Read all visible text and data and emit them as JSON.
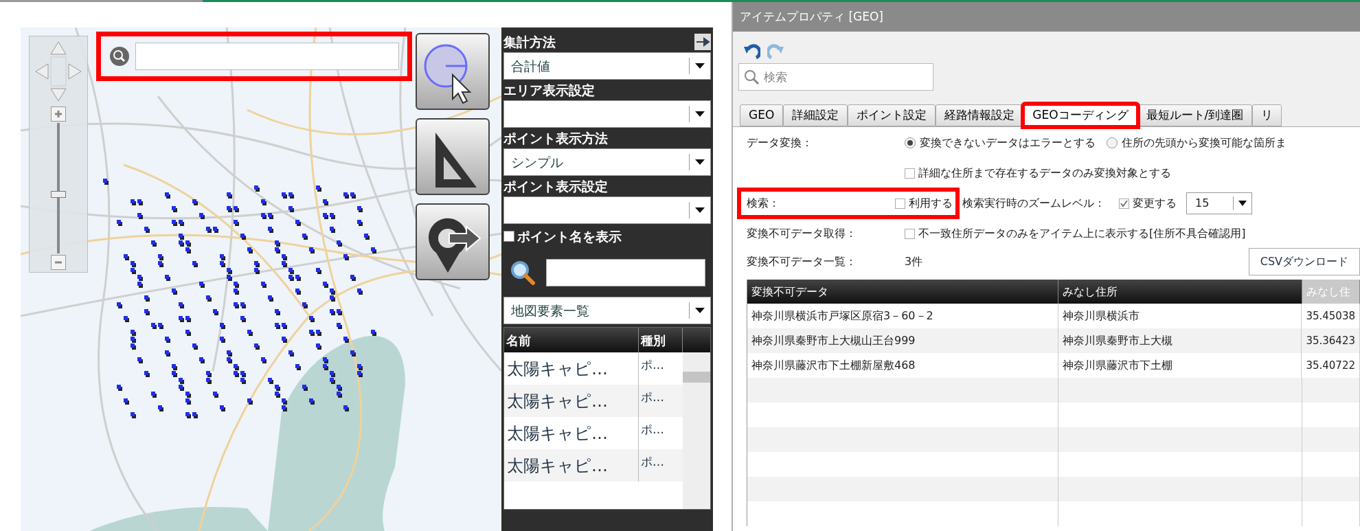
{
  "map": {
    "search": {
      "highlighted": true
    },
    "zoom_slider": {
      "level": 0.45
    }
  },
  "sidebar": {
    "sections": [
      {
        "label": "集計方法",
        "value": "合計値"
      },
      {
        "label": "エリア表示設定"
      },
      {
        "label": "ポイント表示方法",
        "value": "シンプル"
      },
      {
        "label": "ポイント表示設定"
      }
    ],
    "show_point_names": {
      "label": "ポイント名を表示",
      "checked": false
    },
    "list_select": "地図要素一覧",
    "list": {
      "columns": [
        "名前",
        "種別"
      ],
      "rows": [
        [
          "太陽キャピ…",
          "ポ…"
        ],
        [
          "太陽キャピ…",
          "ポ…"
        ],
        [
          "太陽キャピ…",
          "ポ…"
        ],
        [
          "太陽キャピ…",
          "ポ…"
        ]
      ]
    }
  },
  "properties": {
    "title": "アイテムプロパティ [GEO]",
    "search": {
      "placeholder": "検索"
    },
    "tabs": [
      {
        "label": "GEO",
        "selected": false,
        "highlighted": false
      },
      {
        "label": "詳細設定",
        "selected": false,
        "highlighted": false
      },
      {
        "label": "ポイント設定",
        "selected": false,
        "highlighted": false
      },
      {
        "label": "経路情報設定",
        "selected": false,
        "highlighted": false
      },
      {
        "label": "GEOコーディング",
        "selected": true,
        "highlighted": true
      },
      {
        "label": "最短ルート/到達圏",
        "selected": false,
        "highlighted": false
      },
      {
        "label": "リ",
        "selected": false,
        "highlighted": false
      }
    ],
    "data_conversion": {
      "label": "データ変換：",
      "options": [
        {
          "label": "変換できないデータはエラーとする",
          "selected": true
        },
        {
          "label": "住所の先頭から変換可能な箇所ま",
          "selected": false
        }
      ],
      "detail_checkbox": {
        "label": "詳細な住所まで存在するデータのみ変換対象とする",
        "checked": false
      }
    },
    "search_setting": {
      "label": "検索：",
      "highlighted": true,
      "use": {
        "label": "利用する",
        "checked": false
      },
      "zoom_label": "検索実行時のズームレベル：",
      "change": {
        "label": "変更する",
        "checked": true
      },
      "zoom_value": "15"
    },
    "failed_fetch": {
      "label": "変換不可データ取得：",
      "checkbox": {
        "label": "不一致住所データのみをアイテム上に表示する[住所不具合確認用]",
        "checked": false
      }
    },
    "failed_list": {
      "label": "変換不可データ一覧：",
      "count": "3件",
      "button": "CSVダウンロード"
    },
    "table": {
      "columns": [
        "変換不可データ",
        "みなし住所",
        "みなし住"
      ],
      "rows": [
        [
          "神奈川県横浜市戸塚区原宿3－60－2",
          "神奈川県横浜市",
          "35.45038"
        ],
        [
          "神奈川県秦野市上大槻山王台999",
          "神奈川県秦野市上大槻",
          "35.36423"
        ],
        [
          "神奈川県藤沢市下土棚新屋敷468",
          "神奈川県藤沢市下土棚",
          "35.40722"
        ]
      ]
    }
  }
}
